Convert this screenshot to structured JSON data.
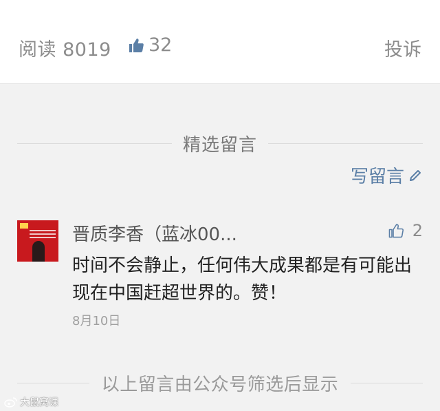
{
  "stats": {
    "reads_label": "阅读 8019",
    "likes_count": "32",
    "report_label": "投诉"
  },
  "comments_section": {
    "title": "精选留言",
    "write_label": "写留言",
    "comments": [
      {
        "nickname": "晋质李香（蓝冰00...",
        "text": "时间不会静止，任何伟大成果都是有可能出现在中国赶超世界的。赞！",
        "date": "8月10日",
        "likes": "2"
      }
    ],
    "footer_note": "以上留言由公众号筛选后显示"
  },
  "watermark": {
    "text": "大鼠窝课"
  },
  "colors": {
    "accent_link": "#5b7fa6",
    "muted_text": "#8c8c8c",
    "avatar_red": "#c8191e"
  }
}
